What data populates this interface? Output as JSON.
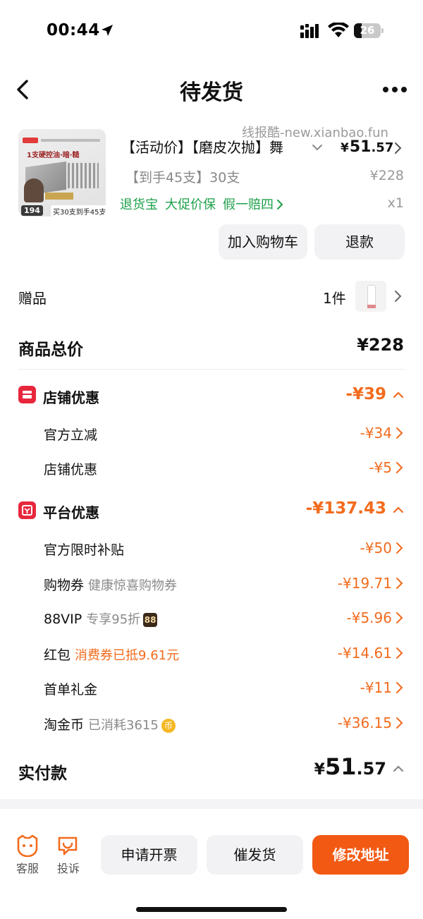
{
  "status_bar": {
    "time": "00:44",
    "battery": "26"
  },
  "nav": {
    "title": "待发货"
  },
  "watermark": "线报酷-new.xianbao.fun",
  "product": {
    "image_text": {
      "headline": "1支硬控油·暗·糙",
      "price": "194",
      "tag": "买30支到手45支"
    },
    "title": "【活动价】【磨皮次抛】舞",
    "price_currency": "¥",
    "price_int": "51",
    "price_dec": ".57",
    "spec": "【到手45支】30支",
    "original_price": "¥228",
    "services": [
      "退货宝",
      "大促价保",
      "假一赔四"
    ],
    "quantity": "x1",
    "buttons": {
      "add_to_cart": "加入购物车",
      "refund": "退款"
    }
  },
  "gift": {
    "label": "赠品",
    "count": "1件"
  },
  "total": {
    "label": "商品总价",
    "value": "¥228"
  },
  "store_discount": {
    "label": "店铺优惠",
    "value": "-¥39",
    "items": [
      {
        "label": "官方立减",
        "value": "-¥34"
      },
      {
        "label": "店铺优惠",
        "value": "-¥5"
      }
    ]
  },
  "platform_discount": {
    "label": "平台优惠",
    "value": "-¥137.43",
    "items": [
      {
        "label": "官方限时补贴",
        "note": "",
        "value": "-¥50"
      },
      {
        "label": "购物券",
        "note": "健康惊喜购物券",
        "value": "-¥19.71"
      },
      {
        "label": "88VIP",
        "note": "专享95折",
        "badge": "88",
        "value": "-¥5.96"
      },
      {
        "label": "红包",
        "note": "消费券已抵9.61元",
        "value": "-¥14.61"
      },
      {
        "label": "首单礼金",
        "note": "",
        "value": "-¥11"
      },
      {
        "label": "淘金币",
        "note": "已消耗3615",
        "coin": "币",
        "value": "-¥36.15"
      }
    ]
  },
  "paid": {
    "label": "实付款",
    "currency": "¥",
    "int": "51",
    "dec": ".57"
  },
  "bottom_bar": {
    "service": "客服",
    "complaint": "投诉",
    "invoice": "申请开票",
    "urge": "催发货",
    "modify_address": "修改地址"
  },
  "colors": {
    "accent_orange": "#f25a14",
    "discount_orange": "#f26b1d",
    "service_green": "#1ea04a",
    "badge_red": "#e8273d"
  }
}
